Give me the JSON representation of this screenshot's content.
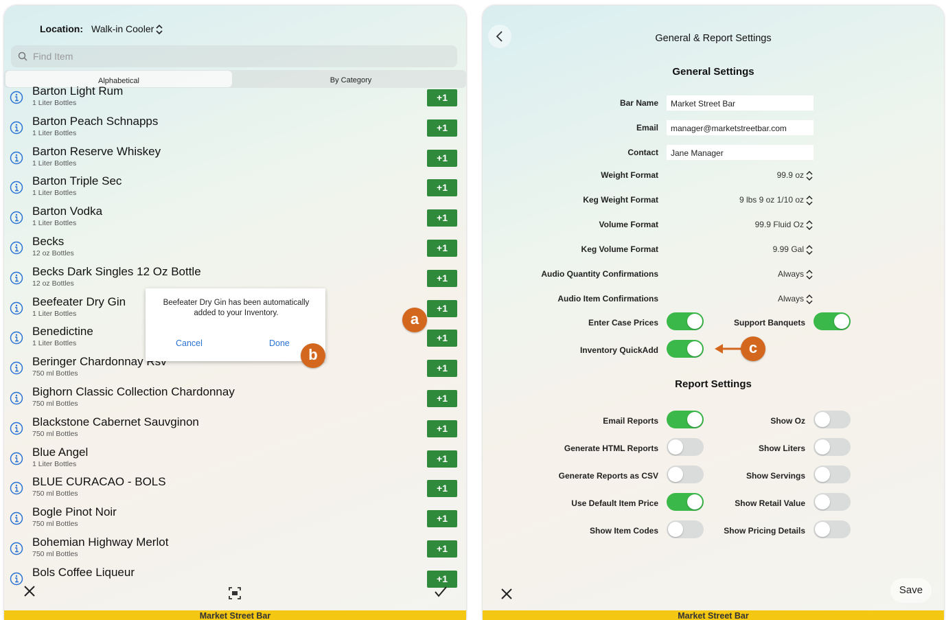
{
  "left": {
    "location_label": "Location:",
    "location_value": "Walk-in Cooler",
    "search_placeholder": "Find Item",
    "tabs": [
      "Alphabetical",
      "By Category"
    ],
    "plus_label": "+1",
    "items": [
      {
        "name": "Barton Light Rum",
        "sub": "1 Liter Bottles"
      },
      {
        "name": "Barton Peach Schnapps",
        "sub": "1 Liter Bottles"
      },
      {
        "name": "Barton Reserve Whiskey",
        "sub": "1 Liter Bottles"
      },
      {
        "name": "Barton Triple Sec",
        "sub": "1 Liter Bottles"
      },
      {
        "name": "Barton Vodka",
        "sub": "1 Liter Bottles"
      },
      {
        "name": "Becks",
        "sub": "12 oz Bottles"
      },
      {
        "name": "Becks Dark Singles 12 Oz Bottle",
        "sub": "12 oz Bottles"
      },
      {
        "name": "Beefeater Dry Gin",
        "sub": "1 Liter Bottles"
      },
      {
        "name": "Benedictine",
        "sub": "1 Liter Bottles"
      },
      {
        "name": "Beringer Chardonnay Rsv",
        "sub": "750 ml Bottles"
      },
      {
        "name": "Bighorn Classic Collection Chardonnay",
        "sub": "750 ml Bottles"
      },
      {
        "name": "Blackstone Cabernet Sauvginon",
        "sub": "750 ml Bottles"
      },
      {
        "name": "Blue Angel",
        "sub": "1 Liter Bottles"
      },
      {
        "name": "BLUE CURACAO - BOLS",
        "sub": "750 ml Bottles"
      },
      {
        "name": "Bogle Pinot Noir",
        "sub": "750 ml Bottles"
      },
      {
        "name": "Bohemian Highway Merlot",
        "sub": "750 ml Bottles"
      },
      {
        "name": "Bols Coffee Liqueur",
        "sub": ""
      }
    ],
    "dialog": {
      "message": "Beefeater Dry Gin has been automatically added to your Inventory.",
      "cancel": "Cancel",
      "done": "Done"
    },
    "footer": "Market Street Bar"
  },
  "badges": {
    "a": "a",
    "b": "b",
    "c": "c"
  },
  "right": {
    "title": "General & Report Settings",
    "general_heading": "General Settings",
    "fields": [
      {
        "label": "Bar Name",
        "value": "Market Street Bar"
      },
      {
        "label": "Email",
        "value": "manager@marketstreetbar.com"
      },
      {
        "label": "Contact",
        "value": "Jane Manager"
      }
    ],
    "pickers": [
      {
        "label": "Weight Format",
        "value": "99.9 oz"
      },
      {
        "label": "Keg Weight Format",
        "value": "9 lbs 9 oz 1/10 oz"
      },
      {
        "label": "Volume Format",
        "value": "99.9 Fluid Oz"
      },
      {
        "label": "Keg Volume Format",
        "value": "9.99 Gal"
      },
      {
        "label": "Audio Quantity Confirmations",
        "value": "Always"
      },
      {
        "label": "Audio Item Confirmations",
        "value": "Always"
      }
    ],
    "enter_case_prices": {
      "label": "Enter Case Prices",
      "on": true
    },
    "support_banquets": {
      "label": "Support Banquets",
      "on": true
    },
    "inventory_quickadd": {
      "label": "Inventory QuickAdd",
      "on": true
    },
    "report_heading": "Report Settings",
    "report_left": [
      {
        "label": "Email Reports",
        "on": true
      },
      {
        "label": "Generate HTML Reports",
        "on": false
      },
      {
        "label": "Generate Reports as CSV",
        "on": false
      },
      {
        "label": "Use Default Item Price",
        "on": true
      },
      {
        "label": "Show Item Codes",
        "on": false
      }
    ],
    "report_right": [
      {
        "label": "Show Oz",
        "on": false
      },
      {
        "label": "Show Liters",
        "on": false
      },
      {
        "label": "Show Servings",
        "on": false
      },
      {
        "label": "Show Retail Value",
        "on": false
      },
      {
        "label": "Show Pricing Details",
        "on": false
      }
    ],
    "save": "Save",
    "footer": "Market Street Bar",
    "colors": {
      "toggle_on": "#3bb84a",
      "plus_button": "#2f8a3c",
      "badge": "#d4671e",
      "footer": "#f3c712",
      "link": "#2a72d4"
    }
  }
}
